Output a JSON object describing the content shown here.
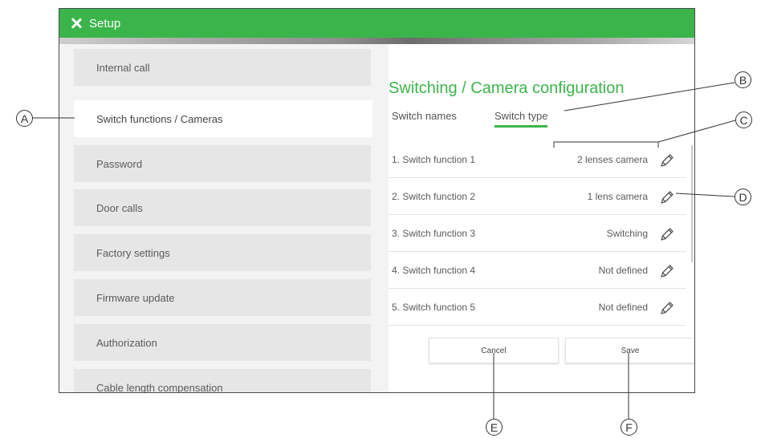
{
  "window": {
    "title": "Setup"
  },
  "sidebar": {
    "items": [
      {
        "label": "Internal call",
        "active": false
      },
      {
        "label": "Switch functions / Cameras",
        "active": true
      },
      {
        "label": "Password",
        "active": false
      },
      {
        "label": "Door calls",
        "active": false
      },
      {
        "label": "Factory settings",
        "active": false
      },
      {
        "label": "Firmware update",
        "active": false
      },
      {
        "label": "Authorization",
        "active": false
      },
      {
        "label": "Cable length compensation",
        "active": false
      }
    ]
  },
  "main": {
    "title": "Switching / Camera configuration",
    "tabs": [
      {
        "label": "Switch names",
        "active": false
      },
      {
        "label": "Switch type",
        "active": true
      }
    ],
    "rows": [
      {
        "name": "1. Switch function 1",
        "value": "2 lenses camera"
      },
      {
        "name": "2. Switch function 2",
        "value": "1 lens camera"
      },
      {
        "name": "3. Switch function 3",
        "value": "Switching"
      },
      {
        "name": "4. Switch function 4",
        "value": "Not defined"
      },
      {
        "name": "5. Switch function 5",
        "value": "Not defined"
      }
    ],
    "cancel_label": "Cancel",
    "save_label": "Save"
  },
  "callouts": {
    "a": "A",
    "b": "B",
    "c": "C",
    "d": "D",
    "e": "E",
    "f": "F"
  },
  "colors": {
    "accent": "#3bb54a",
    "title_text": "#ffffff"
  },
  "icons": {
    "close": "close-icon",
    "edit": "pencil-icon"
  }
}
